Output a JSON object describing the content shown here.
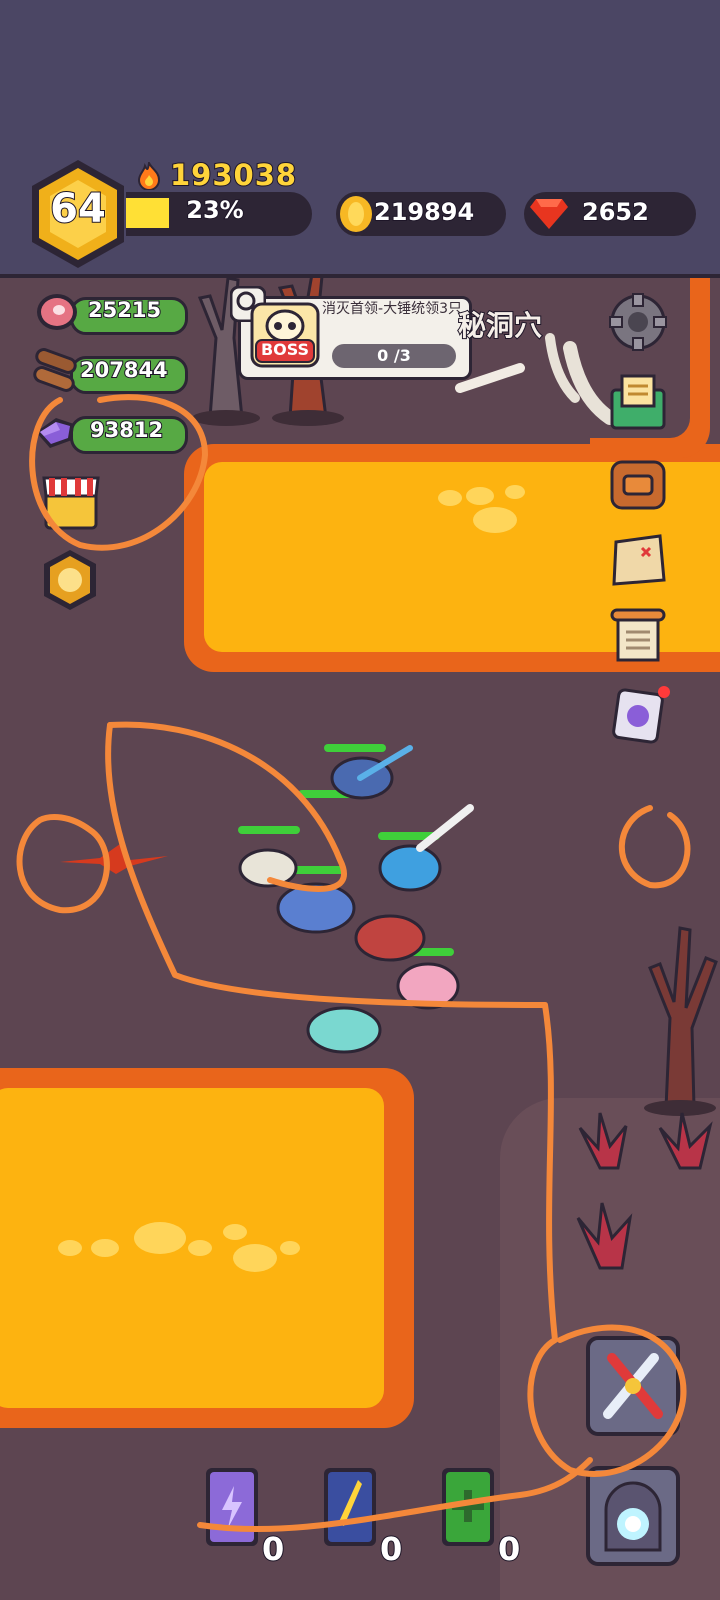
{
  "player": {
    "level": "64",
    "power": "193038",
    "xp_percent_label": "23%",
    "xp_fraction": 0.23
  },
  "currencies": {
    "gold": "219894",
    "gems": "2652"
  },
  "resources": {
    "meat": "25215",
    "wood": "207844",
    "ore": "93812"
  },
  "quest": {
    "badge": "BOSS",
    "title": "消灭首领-大锤统领3只",
    "progress": "0 /3"
  },
  "area_name": "秘洞穴",
  "skill_books": [
    {
      "color": "purple",
      "count": "0"
    },
    {
      "color": "blue",
      "count": "0"
    },
    {
      "color": "green",
      "count": "0"
    }
  ],
  "colors": {
    "lava_outer": "#e9651b",
    "lava_inner": "#fdb310",
    "ground": "#5d4551",
    "resource_pill": "#57a944",
    "gold_text": "#ffd43a",
    "annotation": "#f4883a"
  },
  "icons": [
    "fire-icon",
    "gold-coin-icon",
    "gem-icon",
    "meat-icon",
    "wood-icon",
    "ore-icon",
    "shop-icon",
    "medal-icon",
    "gear-icon",
    "mail-icon",
    "backpack-icon",
    "treasure-map-icon",
    "scroll-icon",
    "boss-card-icon",
    "magnify-icon",
    "skull-icon",
    "swords-icon",
    "portal-icon"
  ]
}
